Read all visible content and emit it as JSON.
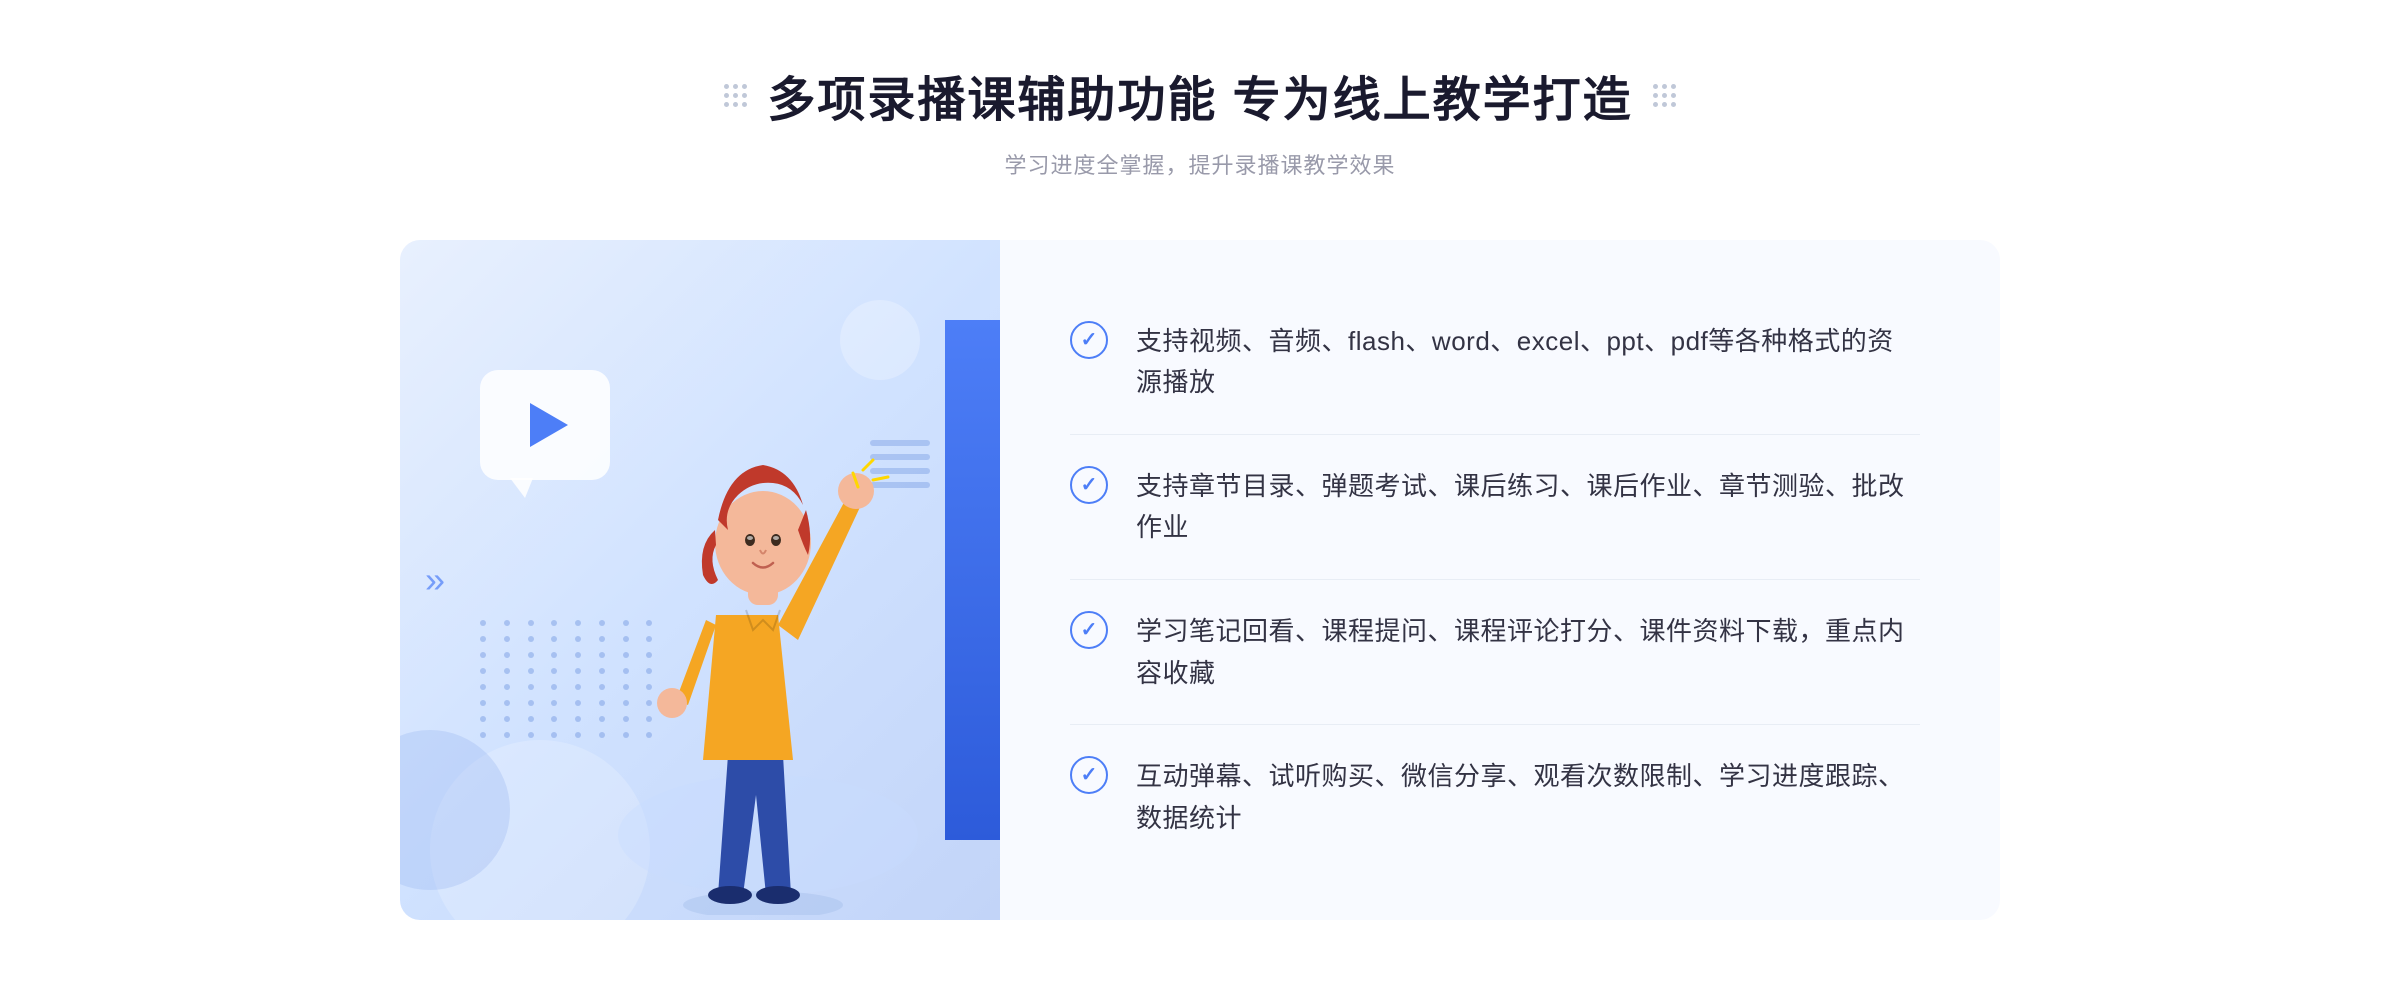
{
  "page": {
    "background": "#ffffff"
  },
  "header": {
    "title": "多项录播课辅助功能 专为线上教学打造",
    "subtitle": "学习进度全掌握，提升录播课教学效果",
    "title_dots_left": "decorative-dots",
    "title_dots_right": "decorative-dots"
  },
  "features": [
    {
      "id": 1,
      "text": "支持视频、音频、flash、word、excel、ppt、pdf等各种格式的资源播放"
    },
    {
      "id": 2,
      "text": "支持章节目录、弹题考试、课后练习、课后作业、章节测验、批改作业"
    },
    {
      "id": 3,
      "text": "学习笔记回看、课程提问、课程评论打分、课件资料下载，重点内容收藏"
    },
    {
      "id": 4,
      "text": "互动弹幕、试听购买、微信分享、观看次数限制、学习进度跟踪、数据统计"
    }
  ],
  "illustration": {
    "play_button_aria": "play-button",
    "person_aria": "person-illustration"
  },
  "colors": {
    "primary": "#4d7ef7",
    "primary_dark": "#2d5bda",
    "text_dark": "#1a1a2e",
    "text_medium": "#333344",
    "text_light": "#999aaa",
    "bg_light": "#f8faff",
    "border": "#e8edf5"
  }
}
